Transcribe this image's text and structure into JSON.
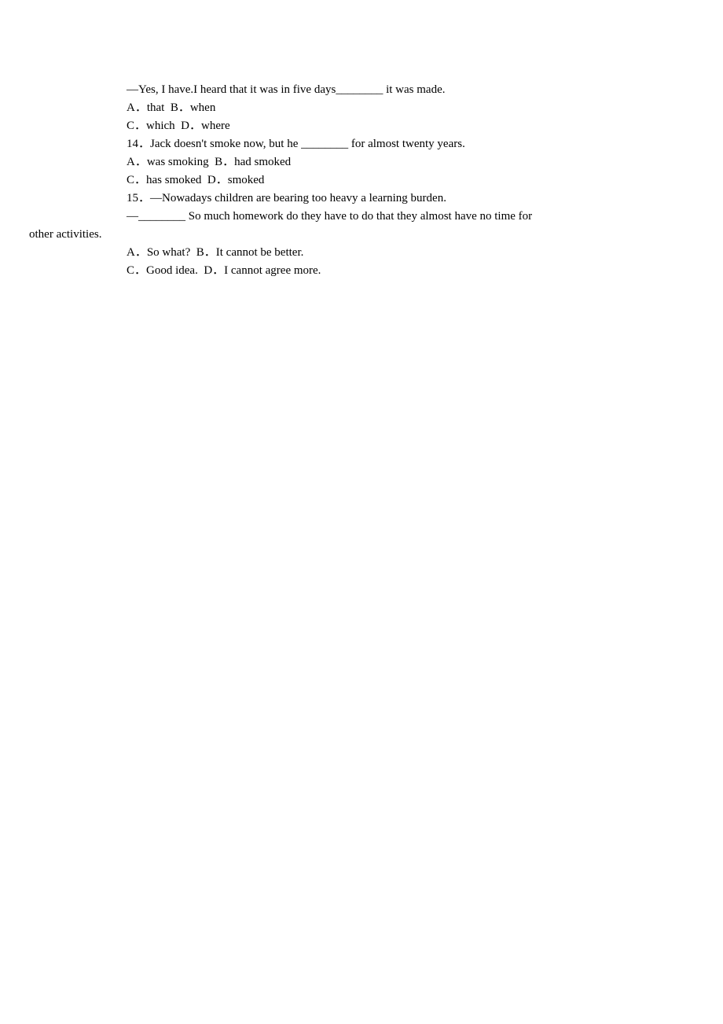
{
  "lines": [
    {
      "class": "indent",
      "text": "—Yes, I have.I heard that it was in five days________ it was made."
    },
    {
      "class": "indent",
      "text": "A．that  B．when"
    },
    {
      "class": "indent",
      "text": "C．which  D．where"
    },
    {
      "class": "indent",
      "text": "14．Jack doesn't smoke now, but he ________ for almost twenty years."
    },
    {
      "class": "indent",
      "text": "A．was smoking  B．had smoked"
    },
    {
      "class": "indent",
      "text": "C．has smoked  D．smoked"
    },
    {
      "class": "indent",
      "text": "15．—Nowadays children are bearing too heavy a learning burden."
    },
    {
      "class": "indent",
      "text": "—________ So much homework do they have to do that they almost have no time for"
    },
    {
      "class": "no-indent",
      "text": "other activities."
    },
    {
      "class": "indent",
      "text": "A．So what?  B．It cannot be better."
    },
    {
      "class": "indent",
      "text": "C．Good idea.  D．I cannot agree more."
    }
  ]
}
